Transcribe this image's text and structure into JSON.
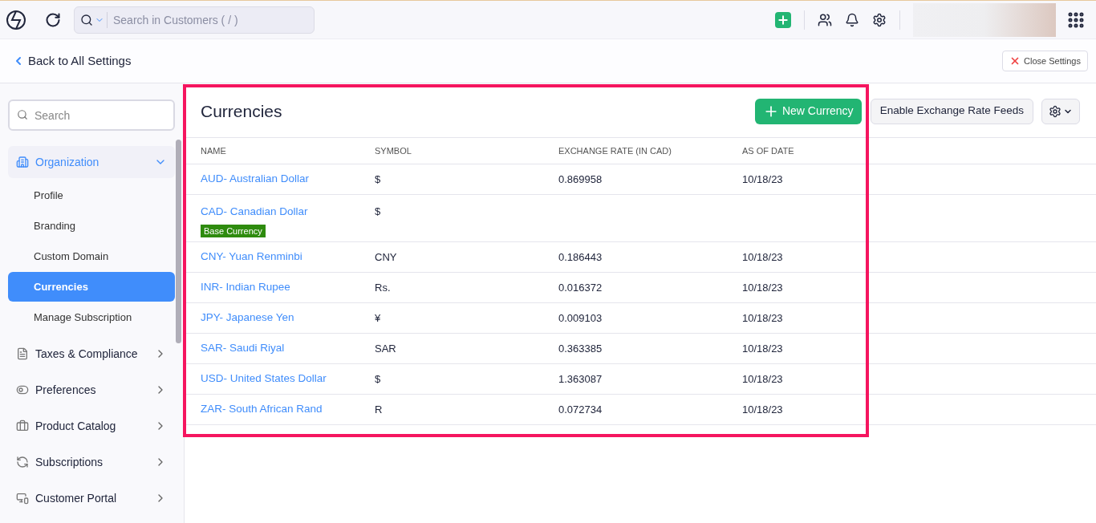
{
  "topbar": {
    "search": {
      "placeholder": "Search in Customers ( / )"
    }
  },
  "header": {
    "back_link": "Back to All Settings",
    "close_button": "Close Settings"
  },
  "sidebar": {
    "search": {
      "placeholder": "Search"
    },
    "sections": [
      {
        "label": "Organization",
        "expanded": true,
        "children": [
          {
            "label": "Profile",
            "selected": false
          },
          {
            "label": "Branding",
            "selected": false
          },
          {
            "label": "Custom Domain",
            "selected": false
          },
          {
            "label": "Currencies",
            "selected": true
          },
          {
            "label": "Manage Subscription",
            "selected": false
          }
        ]
      },
      {
        "label": "Taxes & Compliance",
        "expanded": false
      },
      {
        "label": "Preferences",
        "expanded": false
      },
      {
        "label": "Product Catalog",
        "expanded": false
      },
      {
        "label": "Subscriptions",
        "expanded": false
      },
      {
        "label": "Customer Portal",
        "expanded": false
      }
    ]
  },
  "page": {
    "title": "Currencies",
    "new_button": "New Currency",
    "feeds_button": "Enable Exchange Rate Feeds"
  },
  "table": {
    "columns": [
      "NAME",
      "SYMBOL",
      "EXCHANGE RATE (IN CAD)",
      "AS OF DATE"
    ],
    "rows": [
      {
        "name": "AUD- Australian Dollar",
        "symbol": "$",
        "rate": "0.869958",
        "date": "10/18/23"
      },
      {
        "name": "CAD- Canadian Dollar",
        "badge": "Base Currency",
        "symbol": "$"
      },
      {
        "name": "CNY- Yuan Renminbi",
        "symbol": "CNY",
        "rate": "0.186443",
        "date": "10/18/23"
      },
      {
        "name": "INR- Indian Rupee",
        "symbol": "Rs.",
        "rate": "0.016372",
        "date": "10/18/23"
      },
      {
        "name": "JPY- Japanese Yen",
        "symbol": "¥",
        "rate": "0.009103",
        "date": "10/18/23"
      },
      {
        "name": "SAR- Saudi Riyal",
        "symbol": "SAR",
        "rate": "0.363385",
        "date": "10/18/23"
      },
      {
        "name": "USD- United States Dollar",
        "symbol": "$",
        "rate": "1.363087",
        "date": "10/18/23"
      },
      {
        "name": "ZAR- South African Rand",
        "symbol": "R",
        "rate": "0.072734",
        "date": "10/18/23"
      }
    ]
  }
}
